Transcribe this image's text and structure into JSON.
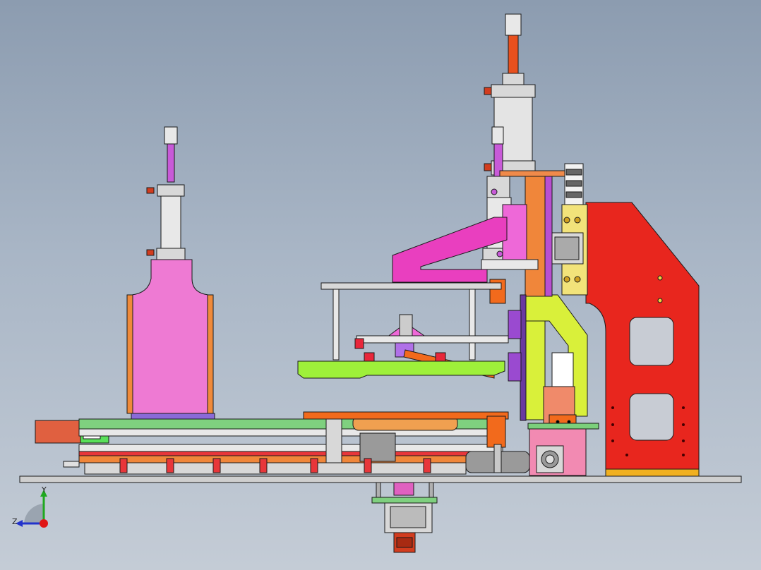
{
  "view": {
    "background_top": "#8c9cb0",
    "background_bottom": "#c4ccd6"
  },
  "part_colors": {
    "frame_red": "#e8261e",
    "magenta": "#e93fbf",
    "pink_block": "#ee7ad3",
    "yellow_green": "#d9f03a",
    "lime": "#9ef03a",
    "orange": "#f26a1c",
    "cylinder_silver": "#d4d6da",
    "base_plate": "#cfcfcf",
    "green": "#17c23d"
  },
  "orientation_triad": {
    "y_label": "Y",
    "z_label": "Z",
    "y_color": "#1fa81f",
    "z_color": "#2233cc",
    "x_color": "#e01515"
  }
}
